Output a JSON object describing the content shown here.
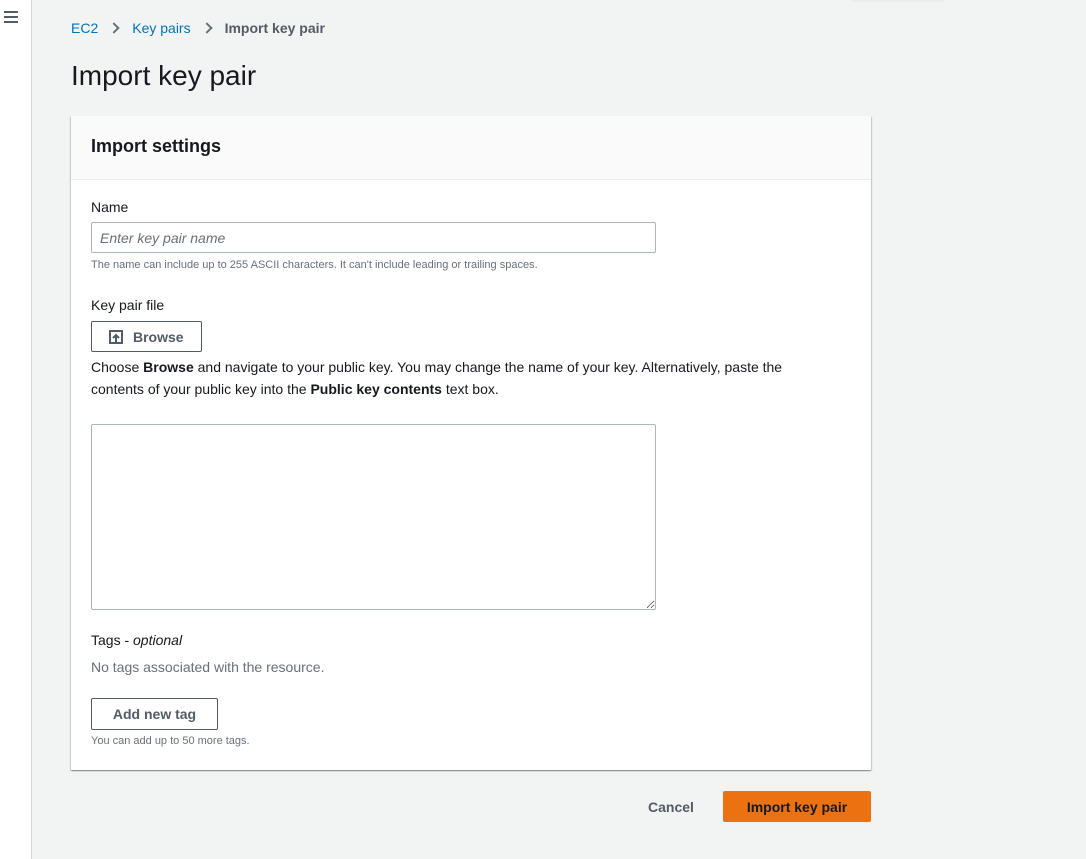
{
  "breadcrumb": {
    "items": [
      "EC2",
      "Key pairs"
    ],
    "current": "Import key pair"
  },
  "page": {
    "title": "Import key pair"
  },
  "settings": {
    "title": "Import settings",
    "name": {
      "label": "Name",
      "value": "",
      "placeholder": "Enter key pair name",
      "hint": "The name can include up to 255 ASCII characters. It can't include leading or trailing spaces."
    },
    "key_file": {
      "label": "Key pair file",
      "browse_label": "Browse",
      "desc_1": "Choose ",
      "desc_browse": "Browse",
      "desc_2": " and navigate to your public key. You may change the name of your key. Alternatively, paste the contents of your public key into the ",
      "desc_public_key": "Public key contents",
      "desc_3": " text box.",
      "contents_value": ""
    },
    "tags": {
      "label": "Tags - ",
      "optional": "optional",
      "empty_text": "No tags associated with the resource.",
      "add_label": "Add new tag",
      "hint": "You can add up to 50 more tags."
    }
  },
  "actions": {
    "cancel_label": "Cancel",
    "submit_label": "Import key pair"
  },
  "icons": {
    "menu": "hamburger-menu-icon",
    "upload": "upload-icon",
    "separator": "chevron-right-icon"
  },
  "colors": {
    "link": "#0073bb",
    "primary_button": "#ec7211",
    "background": "#f2f3f3"
  }
}
